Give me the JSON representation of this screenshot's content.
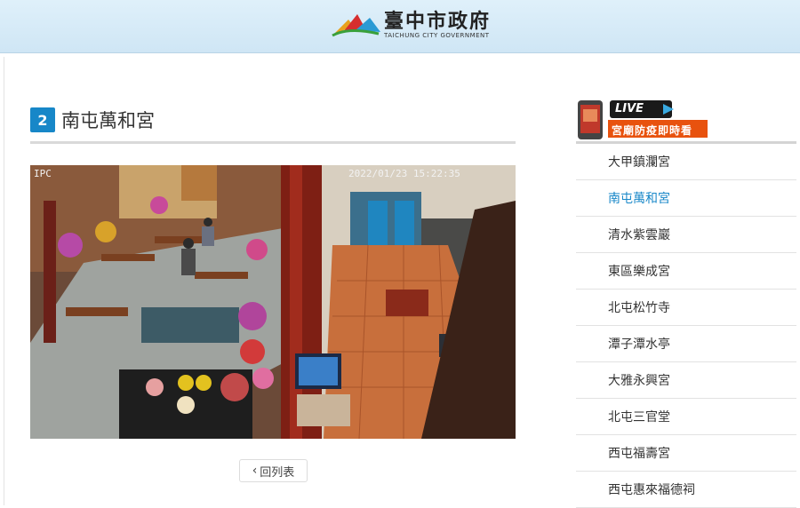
{
  "header": {
    "logo_cn": "臺中市政府",
    "logo_en": "TAICHUNG CITY GOVERNMENT"
  },
  "main": {
    "number": "2",
    "title": "南屯萬和宮",
    "camera": {
      "label": "IPC",
      "timestamp": "2022/01/23 15:22:35"
    },
    "back_label": "回列表"
  },
  "sidebar": {
    "banner": {
      "live": "LIVE",
      "text": "宮廟防疫即時看"
    },
    "items": [
      {
        "label": "大甲鎮瀾宮",
        "active": false
      },
      {
        "label": "南屯萬和宮",
        "active": true
      },
      {
        "label": "清水紫雲巖",
        "active": false
      },
      {
        "label": "東區樂成宮",
        "active": false
      },
      {
        "label": "北屯松竹寺",
        "active": false
      },
      {
        "label": "潭子潭水亭",
        "active": false
      },
      {
        "label": "大雅永興宮",
        "active": false
      },
      {
        "label": "北屯三官堂",
        "active": false
      },
      {
        "label": "西屯福壽宮",
        "active": false
      },
      {
        "label": "西屯惠來福德祠",
        "active": false
      }
    ]
  },
  "colors": {
    "accent": "#1787c8",
    "header_bg": "#d8ecf8",
    "banner_orange": "#e8520e"
  }
}
